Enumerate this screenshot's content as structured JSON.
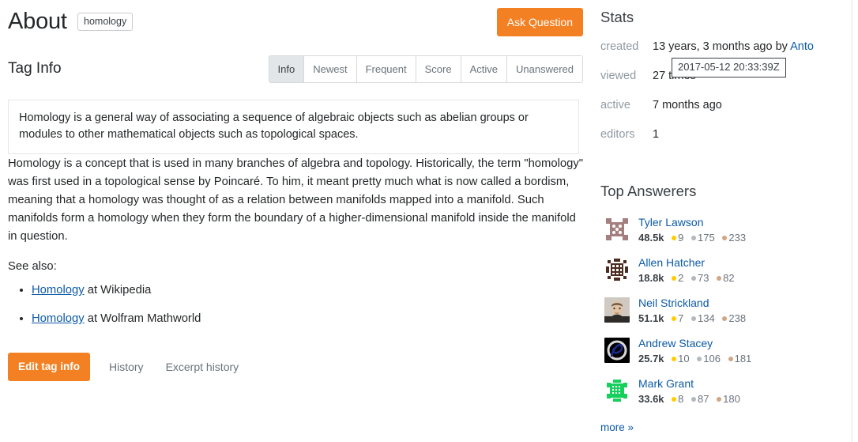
{
  "header": {
    "title": "About",
    "tag": "homology",
    "ask_question_label": "Ask Question"
  },
  "taginfo": {
    "heading": "Tag Info",
    "tabs": [
      {
        "label": "Info",
        "active": true
      },
      {
        "label": "Newest",
        "active": false
      },
      {
        "label": "Frequent",
        "active": false
      },
      {
        "label": "Score",
        "active": false
      },
      {
        "label": "Active",
        "active": false
      },
      {
        "label": "Unanswered",
        "active": false
      }
    ]
  },
  "excerpt": "Homology is a general way of associating a sequence of algebraic objects such as abelian groups or modules to other mathematical objects such as topological spaces.",
  "body": "Homology is a concept that is used in many branches of algebra and topology. Historically, the term \"homology\" was first used in a topological sense by Poincaré. To him, it meant pretty much what is now called a bordism, meaning that a homology was thought of as a relation between manifolds mapped into a manifold. Such manifolds form a homology when they form the boundary of a higher-dimensional manifold inside the manifold in question.",
  "see_also": {
    "heading": "See also:",
    "items": [
      {
        "link": "Homology",
        "suffix": " at Wikipedia"
      },
      {
        "link": "Homology",
        "suffix": " at Wolfram Mathworld"
      }
    ]
  },
  "footer": {
    "edit_tag_info": "Edit tag info",
    "history": "History",
    "excerpt_history": "Excerpt history"
  },
  "stats": {
    "title": "Stats",
    "rows": [
      {
        "label": "created",
        "value": "13 years, 3 months ago by ",
        "link": "Anto"
      },
      {
        "label": "viewed",
        "value": "27 times",
        "link": ""
      },
      {
        "label": "active",
        "value": "7 months ago",
        "link": ""
      },
      {
        "label": "editors",
        "value": "1",
        "link": ""
      }
    ],
    "tooltip": "2017-05-12 20:33:39Z"
  },
  "top_answerers": {
    "title": "Top Answerers",
    "more_label": "more »",
    "users": [
      {
        "name": "Tyler Lawson",
        "rep": "48.5k",
        "gold": "9",
        "silver": "175",
        "bronze": "233",
        "avatar": "identicon-mauve"
      },
      {
        "name": "Allen Hatcher",
        "rep": "18.8k",
        "gold": "2",
        "silver": "73",
        "bronze": "82",
        "avatar": "identicon-brown"
      },
      {
        "name": "Neil Strickland",
        "rep": "51.1k",
        "gold": "7",
        "silver": "134",
        "bronze": "238",
        "avatar": "photo-portrait"
      },
      {
        "name": "Andrew Stacey",
        "rep": "25.7k",
        "gold": "10",
        "silver": "106",
        "bronze": "181",
        "avatar": "logo-black-blue"
      },
      {
        "name": "Mark Grant",
        "rep": "33.6k",
        "gold": "8",
        "silver": "87",
        "bronze": "180",
        "avatar": "identicon-green"
      }
    ]
  },
  "colors": {
    "accent_orange": "#f48024",
    "link_blue": "#0c5aa6",
    "muted_gray": "#9199a1",
    "gold": "#ffcc01",
    "silver": "#b4b8bc",
    "bronze": "#d1a684"
  }
}
